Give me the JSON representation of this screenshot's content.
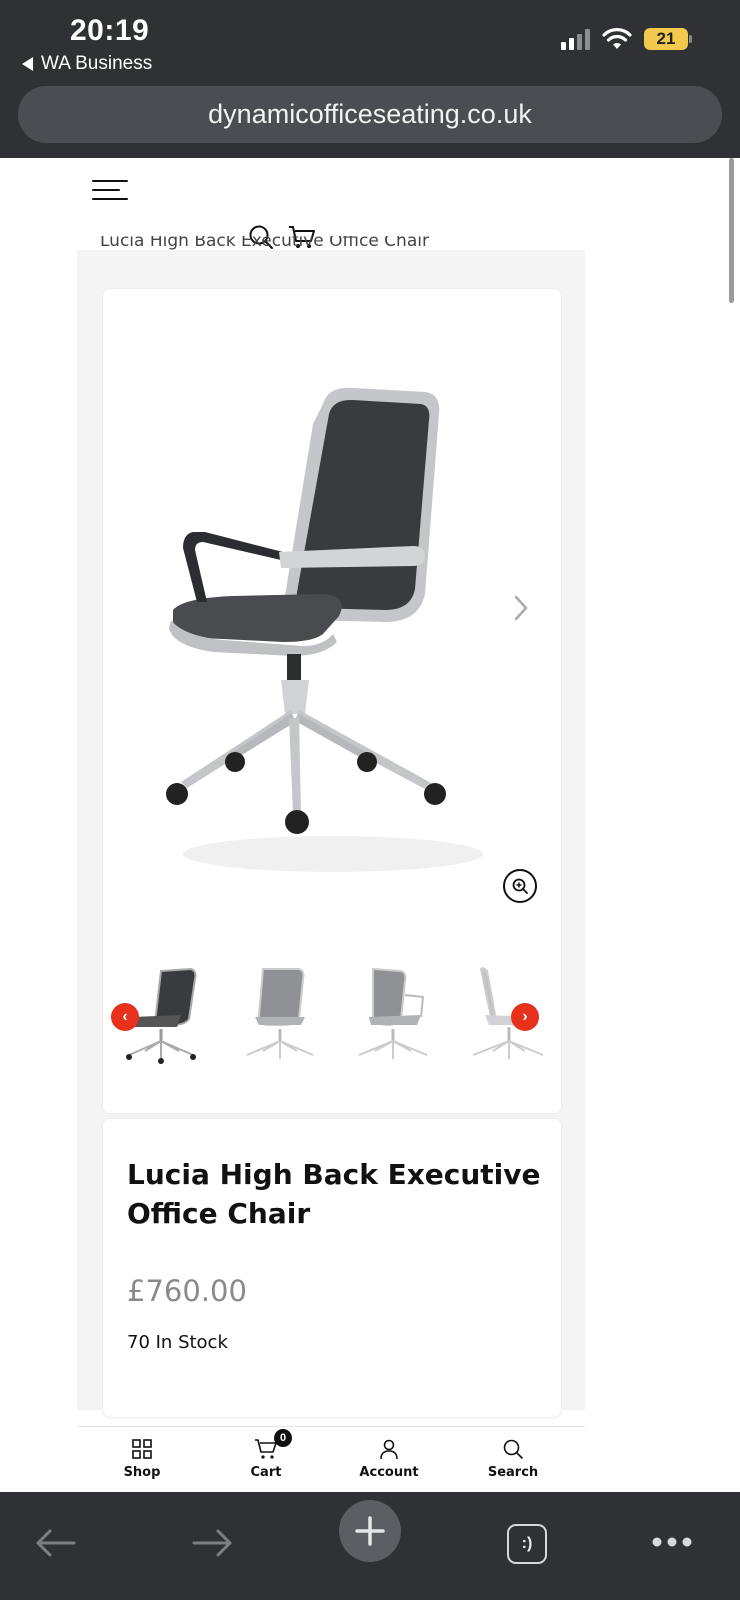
{
  "status_bar": {
    "time": "20:19",
    "back_app_label": "WA Business",
    "battery_level": "21",
    "signal_bars": 2,
    "wifi": true
  },
  "browser": {
    "url": "dynamicofficeseating.co.uk"
  },
  "header": {
    "menu_icon": "hamburger-icon",
    "search_icon": "search-icon",
    "cart_icon": "cart-icon"
  },
  "breadcrumb": {
    "current": "Lucia High Back Executive Office Chair"
  },
  "product": {
    "title": "Lucia High Back Executive Office Chair",
    "price": "£760.00",
    "stock": "70 In Stock",
    "main_image": "office-chair-black",
    "thumbnails": [
      "chair-black-rear",
      "chair-grey-front",
      "chair-grey-angle",
      "chair-white-side"
    ]
  },
  "shop_nav": {
    "items": [
      {
        "label": "Shop",
        "icon": "grid-icon"
      },
      {
        "label": "Cart",
        "icon": "cart-icon",
        "badge": "0"
      },
      {
        "label": "Account",
        "icon": "user-icon"
      },
      {
        "label": "Search",
        "icon": "search-icon"
      }
    ]
  },
  "toolbar": {
    "tabs_label": ":)"
  },
  "colors": {
    "accent": "#e8311c",
    "chrome": "#2f3134",
    "price": "#8a8a8a"
  }
}
